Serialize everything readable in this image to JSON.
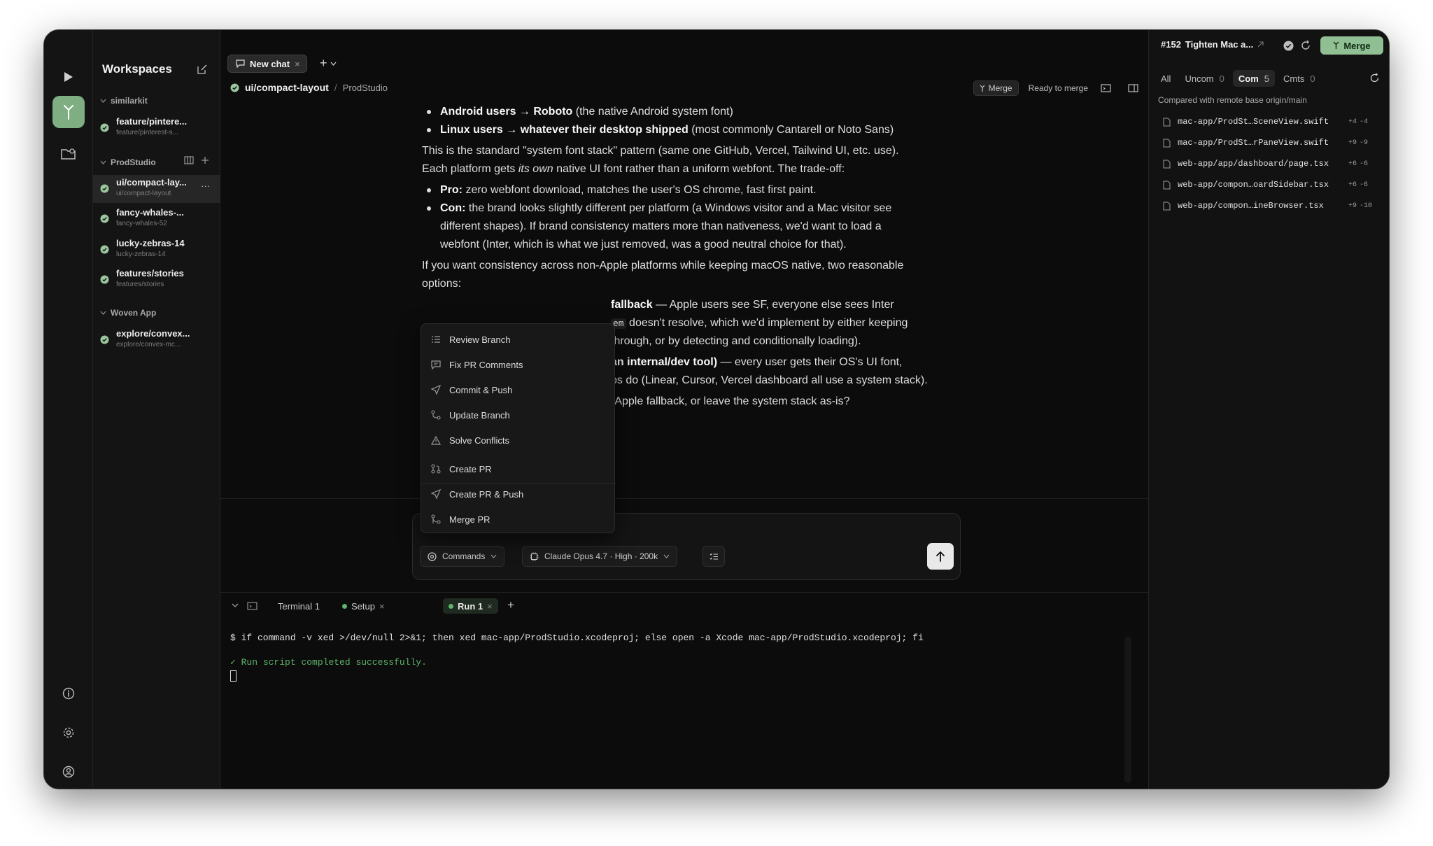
{
  "colors": {
    "traffic_red": "#fe5f57",
    "traffic_yellow": "#febc2e",
    "traffic_green": "#28c840",
    "accent_green": "#8fbf92",
    "success": "#5fb36a"
  },
  "sidebar": {
    "title": "Workspaces",
    "groups": [
      {
        "name": "similarkit",
        "items": [
          {
            "title": "feature/pintere...",
            "subtitle": "feature/pinterest-s..."
          }
        ]
      },
      {
        "name": "ProdStudio",
        "items": [
          {
            "title": "ui/compact-lay...",
            "subtitle": "ui/compact-layout"
          },
          {
            "title": "fancy-whales-...",
            "subtitle": "fancy-whales-52"
          },
          {
            "title": "lucky-zebras-14",
            "subtitle": "lucky-zebras-14"
          },
          {
            "title": "features/stories",
            "subtitle": "features/stories"
          }
        ]
      },
      {
        "name": "Woven App",
        "items": [
          {
            "title": "explore/convex...",
            "subtitle": "explore/convex-mc..."
          }
        ]
      }
    ],
    "more_label": "···"
  },
  "tabs": {
    "active_label": "New chat",
    "close": "×",
    "add": "+"
  },
  "breadcrumb": {
    "branch": "ui/compact-layout",
    "sep": "/",
    "project": "ProdStudio"
  },
  "header_right": {
    "merge_label": "Merge",
    "status": "Ready to merge"
  },
  "chat": {
    "b1_bold": "Android users → Roboto",
    "b1_rest": " (the native Android system font)",
    "b2_bold": "Linux users → whatever their desktop shipped",
    "b2_rest": " (most commonly Cantarell or Noto Sans)",
    "p1_a": "This is the standard \"system font stack\" pattern (same one GitHub, Vercel, Tailwind UI, etc. use).",
    "p1_b": "Each platform gets ",
    "p1_em": "its own",
    "p1_c": " native UI font rather than a uniform webfont. The trade-off:",
    "pro_bold": "Pro:",
    "pro_rest": " zero webfont download, matches the user's OS chrome, fast first paint.",
    "con_bold": "Con:",
    "con_1": " the brand looks slightly different per platform (a Windows visitor and a Mac visitor see",
    "con_2": "different shapes). If brand consistency matters more than nativeness, we'd want to load a",
    "con_3": "webfont (Inter, which is what we just removed, was a good neutral choice for that).",
    "p2_a": "If you want consistency across non-Apple platforms while keeping macOS native, two reasonable",
    "p2_b": "options:",
    "o1_bold": "fallback",
    "o1_rest": " — Apple users see SF, everyone else sees Inter",
    "o1_code": "em",
    "o1_2": " doesn't resolve, which we'd implement by either keeping",
    "o1_3": "through, or by detecting and conditionally loading).",
    "o2_bold": "an internal/dev tool)",
    "o2_rest": " — every user gets their OS's UI font,",
    "o2_2": "ps do (Linear, Cursor, Vercel dashboard all use a system stack).",
    "q": "-Apple fallback, or leave the system stack as-is?"
  },
  "menu": {
    "items": [
      "Review Branch",
      "Fix PR Comments",
      "Commit & Push",
      "Update Branch",
      "Solve Conflicts",
      "Create PR",
      "Create PR & Push",
      "Merge PR"
    ]
  },
  "composer": {
    "commands_label": "Commands",
    "model_label": "Claude Opus 4.7 · High · 200k"
  },
  "terminal": {
    "tabs": [
      "Terminal 1",
      "Setup",
      "Run 1"
    ],
    "close": "×",
    "add": "+",
    "command": "$ if command -v xed >/dev/null 2>&1; then xed mac-app/ProdStudio.xcodeproj; else open -a Xcode mac-app/ProdStudio.xcodeproj; fi",
    "result": "✓ Run script completed successfully."
  },
  "right": {
    "pr_number": "#152",
    "pr_title": "Tighten Mac a...",
    "merge_label": "Merge",
    "filter_tabs": [
      {
        "label": "All",
        "count": ""
      },
      {
        "label": "Uncom",
        "count": "0"
      },
      {
        "label": "Com",
        "count": "5"
      },
      {
        "label": "Cmts",
        "count": "0"
      }
    ],
    "compared": "Compared with remote base origin/main",
    "files": [
      {
        "name": "mac-app/ProdSt…SceneView.swift",
        "add": "+4",
        "del": "-4"
      },
      {
        "name": "mac-app/ProdSt…rPaneView.swift",
        "add": "+9",
        "del": "-9"
      },
      {
        "name": "web-app/app/dashboard/page.tsx",
        "add": "+6",
        "del": "-6"
      },
      {
        "name": "web-app/compon…oardSidebar.tsx",
        "add": "+6",
        "del": "-6"
      },
      {
        "name": "web-app/compon…ineBrowser.tsx",
        "add": "+9",
        "del": "-10"
      }
    ]
  }
}
